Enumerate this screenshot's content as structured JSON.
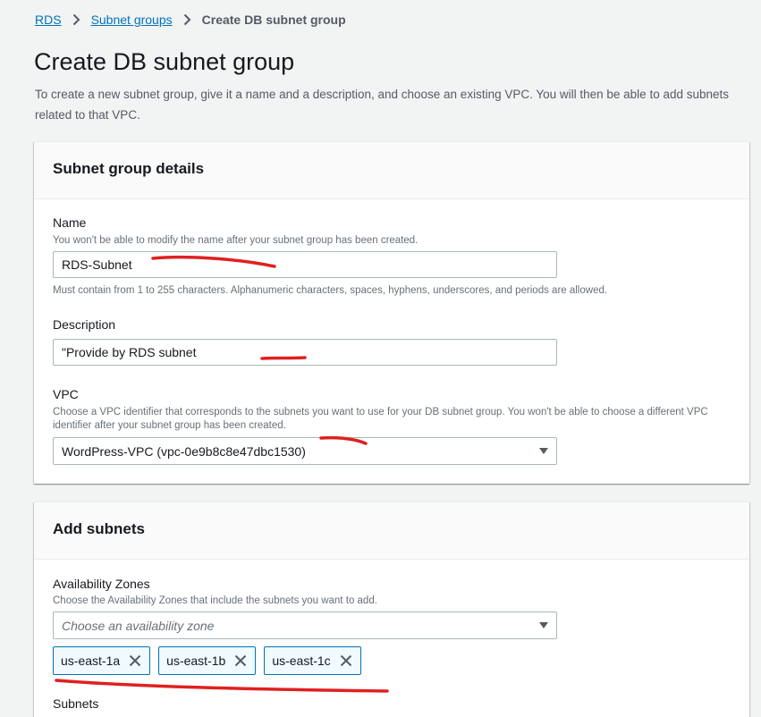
{
  "breadcrumb": {
    "rds": "RDS",
    "subnet_groups": "Subnet groups",
    "current": "Create DB subnet group"
  },
  "page": {
    "title": "Create DB subnet group",
    "description": "To create a new subnet group, give it a name and a description, and choose an existing VPC. You will then be able to add subnets related to that VPC."
  },
  "details": {
    "title": "Subnet group details",
    "name_label": "Name",
    "name_hint": "You won't be able to modify the name after your subnet group has been created.",
    "name_value": "RDS-Subnet",
    "name_constraint": "Must contain from 1 to 255 characters. Alphanumeric characters, spaces, hyphens, underscores, and periods are allowed.",
    "description_label": "Description",
    "description_value": "\"Provide by RDS subnet",
    "vpc_label": "VPC",
    "vpc_hint": "Choose a VPC identifier that corresponds to the subnets you want to use for your DB subnet group. You won't be able to choose a different VPC identifier after your subnet group has been created.",
    "vpc_value": "WordPress-VPC (vpc-0e9b8c8e47dbc1530)"
  },
  "add_subnets": {
    "title": "Add subnets",
    "az_label": "Availability Zones",
    "az_hint": "Choose the Availability Zones that include the subnets you want to add.",
    "az_placeholder": "Choose an availability zone",
    "zones": [
      "us-east-1a",
      "us-east-1b",
      "us-east-1c"
    ],
    "subnets_label": "Subnets"
  },
  "annotation_color": "#e02020",
  "icons": {
    "separator": "chevron-right-icon",
    "select": "caret-down-icon",
    "remove": "close-icon"
  }
}
